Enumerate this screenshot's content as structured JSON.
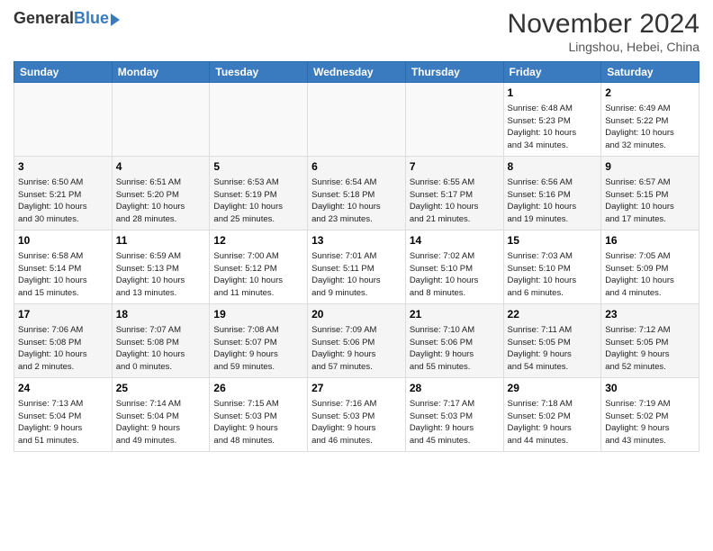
{
  "header": {
    "logo_general": "General",
    "logo_blue": "Blue",
    "month_title": "November 2024",
    "location": "Lingshou, Hebei, China"
  },
  "days_of_week": [
    "Sunday",
    "Monday",
    "Tuesday",
    "Wednesday",
    "Thursday",
    "Friday",
    "Saturday"
  ],
  "weeks": [
    [
      {
        "day": "",
        "info": ""
      },
      {
        "day": "",
        "info": ""
      },
      {
        "day": "",
        "info": ""
      },
      {
        "day": "",
        "info": ""
      },
      {
        "day": "",
        "info": ""
      },
      {
        "day": "1",
        "info": "Sunrise: 6:48 AM\nSunset: 5:23 PM\nDaylight: 10 hours\nand 34 minutes."
      },
      {
        "day": "2",
        "info": "Sunrise: 6:49 AM\nSunset: 5:22 PM\nDaylight: 10 hours\nand 32 minutes."
      }
    ],
    [
      {
        "day": "3",
        "info": "Sunrise: 6:50 AM\nSunset: 5:21 PM\nDaylight: 10 hours\nand 30 minutes."
      },
      {
        "day": "4",
        "info": "Sunrise: 6:51 AM\nSunset: 5:20 PM\nDaylight: 10 hours\nand 28 minutes."
      },
      {
        "day": "5",
        "info": "Sunrise: 6:53 AM\nSunset: 5:19 PM\nDaylight: 10 hours\nand 25 minutes."
      },
      {
        "day": "6",
        "info": "Sunrise: 6:54 AM\nSunset: 5:18 PM\nDaylight: 10 hours\nand 23 minutes."
      },
      {
        "day": "7",
        "info": "Sunrise: 6:55 AM\nSunset: 5:17 PM\nDaylight: 10 hours\nand 21 minutes."
      },
      {
        "day": "8",
        "info": "Sunrise: 6:56 AM\nSunset: 5:16 PM\nDaylight: 10 hours\nand 19 minutes."
      },
      {
        "day": "9",
        "info": "Sunrise: 6:57 AM\nSunset: 5:15 PM\nDaylight: 10 hours\nand 17 minutes."
      }
    ],
    [
      {
        "day": "10",
        "info": "Sunrise: 6:58 AM\nSunset: 5:14 PM\nDaylight: 10 hours\nand 15 minutes."
      },
      {
        "day": "11",
        "info": "Sunrise: 6:59 AM\nSunset: 5:13 PM\nDaylight: 10 hours\nand 13 minutes."
      },
      {
        "day": "12",
        "info": "Sunrise: 7:00 AM\nSunset: 5:12 PM\nDaylight: 10 hours\nand 11 minutes."
      },
      {
        "day": "13",
        "info": "Sunrise: 7:01 AM\nSunset: 5:11 PM\nDaylight: 10 hours\nand 9 minutes."
      },
      {
        "day": "14",
        "info": "Sunrise: 7:02 AM\nSunset: 5:10 PM\nDaylight: 10 hours\nand 8 minutes."
      },
      {
        "day": "15",
        "info": "Sunrise: 7:03 AM\nSunset: 5:10 PM\nDaylight: 10 hours\nand 6 minutes."
      },
      {
        "day": "16",
        "info": "Sunrise: 7:05 AM\nSunset: 5:09 PM\nDaylight: 10 hours\nand 4 minutes."
      }
    ],
    [
      {
        "day": "17",
        "info": "Sunrise: 7:06 AM\nSunset: 5:08 PM\nDaylight: 10 hours\nand 2 minutes."
      },
      {
        "day": "18",
        "info": "Sunrise: 7:07 AM\nSunset: 5:08 PM\nDaylight: 10 hours\nand 0 minutes."
      },
      {
        "day": "19",
        "info": "Sunrise: 7:08 AM\nSunset: 5:07 PM\nDaylight: 9 hours\nand 59 minutes."
      },
      {
        "day": "20",
        "info": "Sunrise: 7:09 AM\nSunset: 5:06 PM\nDaylight: 9 hours\nand 57 minutes."
      },
      {
        "day": "21",
        "info": "Sunrise: 7:10 AM\nSunset: 5:06 PM\nDaylight: 9 hours\nand 55 minutes."
      },
      {
        "day": "22",
        "info": "Sunrise: 7:11 AM\nSunset: 5:05 PM\nDaylight: 9 hours\nand 54 minutes."
      },
      {
        "day": "23",
        "info": "Sunrise: 7:12 AM\nSunset: 5:05 PM\nDaylight: 9 hours\nand 52 minutes."
      }
    ],
    [
      {
        "day": "24",
        "info": "Sunrise: 7:13 AM\nSunset: 5:04 PM\nDaylight: 9 hours\nand 51 minutes."
      },
      {
        "day": "25",
        "info": "Sunrise: 7:14 AM\nSunset: 5:04 PM\nDaylight: 9 hours\nand 49 minutes."
      },
      {
        "day": "26",
        "info": "Sunrise: 7:15 AM\nSunset: 5:03 PM\nDaylight: 9 hours\nand 48 minutes."
      },
      {
        "day": "27",
        "info": "Sunrise: 7:16 AM\nSunset: 5:03 PM\nDaylight: 9 hours\nand 46 minutes."
      },
      {
        "day": "28",
        "info": "Sunrise: 7:17 AM\nSunset: 5:03 PM\nDaylight: 9 hours\nand 45 minutes."
      },
      {
        "day": "29",
        "info": "Sunrise: 7:18 AM\nSunset: 5:02 PM\nDaylight: 9 hours\nand 44 minutes."
      },
      {
        "day": "30",
        "info": "Sunrise: 7:19 AM\nSunset: 5:02 PM\nDaylight: 9 hours\nand 43 minutes."
      }
    ]
  ]
}
